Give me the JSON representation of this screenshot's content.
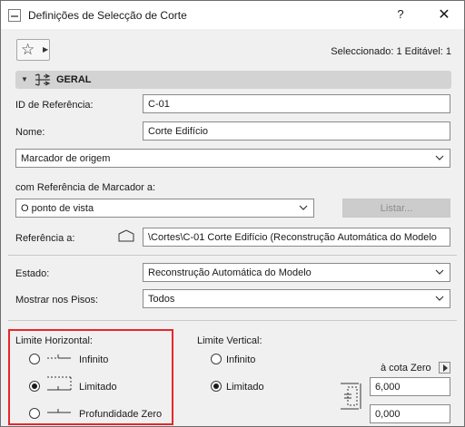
{
  "window": {
    "title": "Definições de Selecção de Corte",
    "help_label": "?",
    "close_label": "✕"
  },
  "toolbar": {
    "favorites_icon": "star-icon",
    "selection_info": "Seleccionado: 1 Editável: 1"
  },
  "section": {
    "name": "GERAL"
  },
  "general": {
    "ref_id_label": "ID de Referência:",
    "ref_id_value": "C-01",
    "name_label": "Nome:",
    "name_value": "Corte Edifício",
    "marker_select": "Marcador de origem",
    "marker_ref_label": "com Referência de Marcador a:",
    "marker_ref_select": "O ponto de vista",
    "list_button": "Listar...",
    "reference_label": "Referência a:",
    "reference_value": "\\Cortes\\C-01 Corte Edifício (Reconstrução Automática do Modelo",
    "state_label": "Estado:",
    "state_select": "Reconstrução Automática do Modelo",
    "show_floors_label": "Mostrar nos Pisos:",
    "show_floors_select": "Todos"
  },
  "horizontal_limit": {
    "label": "Limite Horizontal:",
    "options": [
      "Infinito",
      "Limitado",
      "Profundidade Zero"
    ],
    "selected": "Limitado"
  },
  "vertical_limit": {
    "label": "Limite Vertical:",
    "options": [
      "Infinito",
      "Limitado"
    ],
    "selected": "Limitado",
    "zero_elevation_label": "à cota Zero",
    "top_value": "6,000",
    "bottom_value": "0,000"
  },
  "colors": {
    "highlight_border": "#e8262a",
    "section_header_bg": "#d3d3d3",
    "disabled_button_bg": "#cccccc"
  }
}
